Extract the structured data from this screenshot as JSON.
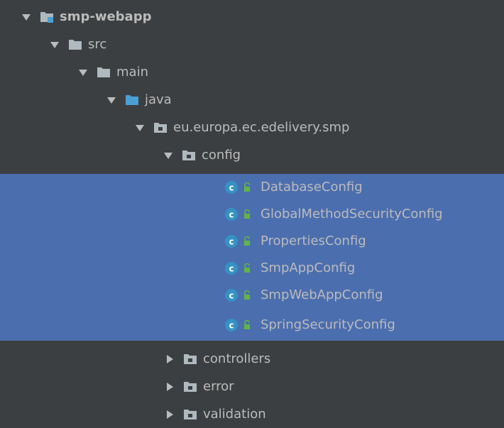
{
  "tree": {
    "root": {
      "label": "smp-webapp",
      "expanded": true
    },
    "src": {
      "label": "src",
      "expanded": true
    },
    "main": {
      "label": "main",
      "expanded": true
    },
    "java": {
      "label": "java",
      "expanded": true
    },
    "package": {
      "label": "eu.europa.ec.edelivery.smp",
      "expanded": true
    },
    "config": {
      "label": "config",
      "expanded": true
    },
    "config_classes": [
      {
        "label": "DatabaseConfig",
        "selected": true
      },
      {
        "label": "GlobalMethodSecurityConfig",
        "selected": true
      },
      {
        "label": "PropertiesConfig",
        "selected": true
      },
      {
        "label": "SmpAppConfig",
        "selected": true
      },
      {
        "label": "SmpWebAppConfig",
        "selected": true
      },
      {
        "label": "SpringSecurityConfig",
        "selected": true
      }
    ],
    "controllers": {
      "label": "controllers",
      "expanded": false
    },
    "error": {
      "label": "error",
      "expanded": false
    },
    "validation": {
      "label": "validation",
      "expanded": false
    }
  },
  "colors": {
    "background": "#3c3f41",
    "selection": "#4b6eaf",
    "text": "#bbbbbb",
    "folder": "#aeb9c0",
    "source_folder": "#4a9fd4",
    "class_icon": "#3592c4",
    "lock_icon": "#62b543"
  }
}
